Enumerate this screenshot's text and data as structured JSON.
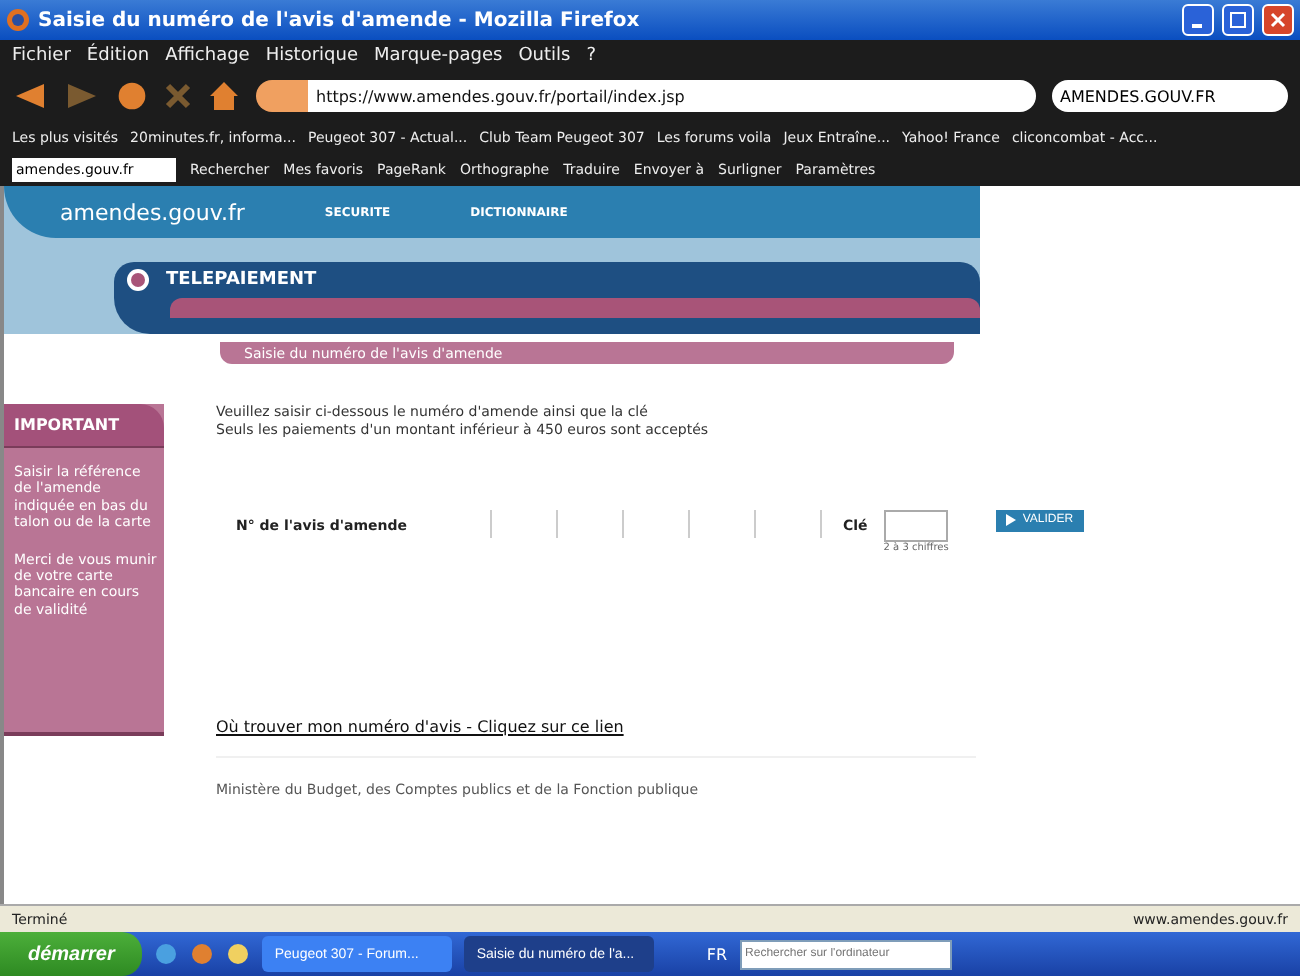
{
  "window": {
    "title": "Saisie du numéro de l'avis d'amende - Mozilla Firefox"
  },
  "menu": [
    "Fichier",
    "Édition",
    "Affichage",
    "Historique",
    "Marque-pages",
    "Outils",
    "?"
  ],
  "navbar": {
    "url": "https://www.amendes.gouv.fr/portail/index.jsp",
    "search": "AMENDES.GOUV.FR"
  },
  "bookmarks": [
    "Les plus visités",
    "20minutes.fr, informa...",
    "Peugeot 307 - Actual...",
    "Club Team Peugeot 307",
    "Les forums voila",
    "Jeux Entraîne...",
    "Yahoo! France",
    "cliconcombat - Acc..."
  ],
  "google_toolbar": {
    "query": "amendes.gouv.fr",
    "items": [
      "Rechercher",
      "Mes favoris",
      "PageRank",
      "Orthographe",
      "Traduire",
      "Envoyer à",
      "Surligner",
      "Paramètres"
    ]
  },
  "site": {
    "logo": "amendes.gouv.fr",
    "nav": [
      "SECURITE",
      "DICTIONNAIRE"
    ],
    "section": "TELEPAIEMENT",
    "subtitle": "Saisie du numéro de l'avis d'amende"
  },
  "sidebar": {
    "title": "IMPORTANT",
    "paragraphs": [
      "Saisir la référence de l'amende indiquée en bas du talon ou de la carte",
      "Merci de vous munir de votre carte bancaire en cours de validité"
    ]
  },
  "form": {
    "intro": [
      "Veuillez saisir ci-dessous le numéro d'amende ainsi que la clé",
      "Seuls les paiements d'un montant inférieur à 450 euros sont acceptés"
    ],
    "label": "N° de l'avis d'amende",
    "key_label": "Clé",
    "key_hint": "2 à 3 chiffres",
    "submit": "VALIDER"
  },
  "help_link": "Où trouver mon numéro d'avis - Cliquez sur ce lien",
  "footer": "Ministère du Budget, des Comptes publics et de la Fonction publique",
  "status_bar": {
    "text": "Terminé",
    "site": "www.amendes.gouv.fr"
  },
  "taskbar": {
    "start": "démarrer",
    "tasks": [
      {
        "label": "Peugeot 307 - Forum...",
        "selected": false
      },
      {
        "label": "Saisie du numéro de l'a...",
        "selected": true
      }
    ],
    "language": "FR",
    "search_placeholder": "Rechercher sur l'ordinateur"
  }
}
